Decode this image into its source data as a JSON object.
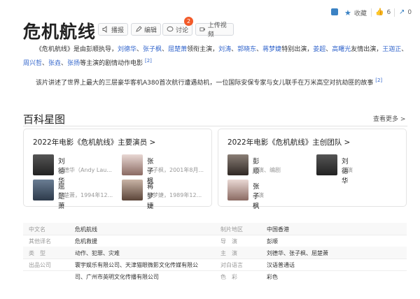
{
  "title": "危机航线",
  "toolbar": {
    "play": "播报",
    "edit": "编辑",
    "discuss": "讨论",
    "discuss_count": "2",
    "upload": "上传视频"
  },
  "top_actions": {
    "collect": "收藏",
    "like_count": "6",
    "share_count": "0"
  },
  "intro": {
    "p1_text": "《危机航线》是由彭顺执导，刘德华、张子枫、屈楚萧领衔主演，刘涛、郭晓东、蒋梦婕特别出演，姜超、高曙光友情出演，王迦正、周兴哲、张垚、张扬等主演的剧情动作电影",
    "p1_ref": "[2]",
    "p2_text": "该片讲述了世界上最大的三层豪华客机A380首次航行遭遇劫机，一位国际安保专家与女儿联手在万米高空对抗劫匪的故事",
    "p2_ref": "[2]"
  },
  "intro_segments": {
    "s1": "《危机航线》是由彭顺执导，",
    "l1": "刘德华",
    "s2": "、",
    "l2": "张子枫",
    "s3": "、",
    "l3": "屈楚萧",
    "s4": "领衔主演，",
    "l4": "刘涛",
    "s5": "、",
    "l5": "郭晓东",
    "s6": "、",
    "l6": "蒋梦婕",
    "s7": "特别出演，",
    "l7": "姜超",
    "s8": "、",
    "l8": "高曙光",
    "s9": "友情出演，",
    "l9": "王迦正",
    "s10": "、",
    "l10": "周兴哲",
    "s11": "、",
    "l11": "张垚",
    "s12": "、",
    "l12": "张扬",
    "s13": "等主演的剧情动作电影"
  },
  "section": {
    "title": "百科星图",
    "more": "查看更多 >"
  },
  "cast_card": {
    "title": "2022年电影《危机航线》主要演员 >",
    "people": [
      {
        "name": "刘德华",
        "desc": "刘德华（Andy Lau..."
      },
      {
        "name": "张子枫",
        "desc": "张子枫，2001年8月..."
      },
      {
        "name": "屈楚萧",
        "desc": "屈楚萧，1994年12..."
      },
      {
        "name": "蒋梦婕",
        "desc": "蒋梦婕，1989年12..."
      }
    ]
  },
  "crew_card": {
    "title": "2022年电影《危机航线》主创团队 >",
    "people": [
      {
        "name": "彭顺",
        "desc": "导演、编剧"
      },
      {
        "name": "刘德华",
        "desc": "主演"
      },
      {
        "name": "张子枫",
        "desc": "主演"
      }
    ]
  },
  "info_table": [
    {
      "k1": "中文名",
      "v1": "危机航线",
      "k2": "制片地区",
      "v2": "中国香港"
    },
    {
      "k1": "其他译名",
      "v1": "危机救援",
      "k2": "导　演",
      "v2": "彭顺"
    },
    {
      "k1": "类　型",
      "v1": "动作、犯罪、灾难",
      "k2": "主　演",
      "v2": "刘德华、张子枫、屈楚萧"
    },
    {
      "k1": "出品公司",
      "v1": "寰宇娱乐有限公司、天津猫眼微影文化传媒有限公",
      "k2": "对白语言",
      "v2": "汉语普通话"
    },
    {
      "k1": "",
      "v1": "司、广州市英明文化传播有限公司",
      "k2": "色　彩",
      "v2": "彩色"
    }
  ],
  "colors": {
    "link": "#3366cc",
    "badge": "#f25a29",
    "icon_blue": "#3b82c4"
  }
}
